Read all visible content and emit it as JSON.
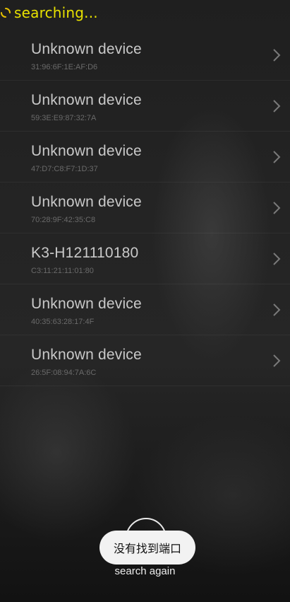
{
  "status": {
    "text": "searching...",
    "icon": "loading-spinner-icon",
    "color": "#e8e200"
  },
  "devices": [
    {
      "name": "Unknown device",
      "mac": "31:96:6F:1E:AF:D6"
    },
    {
      "name": "Unknown device",
      "mac": "59:3E:E9:87:32:7A"
    },
    {
      "name": "Unknown device",
      "mac": "47:D7:C8:F7:1D:37"
    },
    {
      "name": "Unknown device",
      "mac": "70:28:9F:42:35:C8"
    },
    {
      "name": "K3-H121110180",
      "mac": "C3:11:21:11:01:80"
    },
    {
      "name": "Unknown device",
      "mac": "40:35:63:28:17:4F"
    },
    {
      "name": "Unknown device",
      "mac": "26:5F:08:94:7A:6C"
    }
  ],
  "toast": {
    "text": "没有找到端口"
  },
  "search_again": {
    "label": "search again",
    "icon": "refresh-icon"
  }
}
